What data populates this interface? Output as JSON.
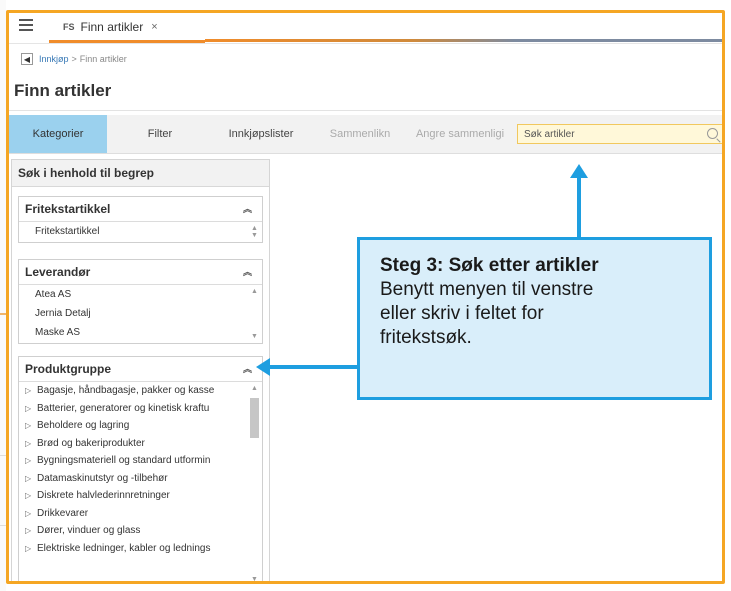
{
  "tab": {
    "badge": "FS",
    "label": "Finn artikler",
    "close": "×"
  },
  "breadcrumb": {
    "parent": "Innkjøp",
    "separator": ">",
    "current": "Finn artikler"
  },
  "page_title": "Finn artikler",
  "toolbar": {
    "kategorier": "Kategorier",
    "filter": "Filter",
    "innkjopslister": "Innkjøpslister",
    "sammenlikn": "Sammenlikn",
    "angre": "Angre sammenligi",
    "search_placeholder": "Søk artikler"
  },
  "left_panel": {
    "heading": "Søk i henhold til begrep",
    "fritekst": {
      "title": "Fritekstartikkel",
      "items": [
        "Fritekstartikkel"
      ]
    },
    "leverandor": {
      "title": "Leverandør",
      "items": [
        "Atea AS",
        "Jernia Detalj",
        "Maske AS"
      ]
    },
    "produktgruppe": {
      "title": "Produktgruppe",
      "items": [
        "Bagasje, håndbagasje, pakker og kasse",
        "Batterier, generatorer og kinetisk kraftu",
        "Beholdere og lagring",
        "Brød og bakeriprodukter",
        "Bygningsmateriell og standard utformin",
        "Datamaskinutstyr og -tilbehør",
        "Diskrete halvlederinnretninger",
        "Drikkevarer",
        "Dører, vinduer og glass",
        "Elektriske ledninger, kabler og lednings"
      ]
    }
  },
  "callout": {
    "title": "Steg 3: Søk etter artikler",
    "body": "Benytt menyen til venstre\neller skriv i feltet for\nfritekstsøk."
  },
  "colors": {
    "accent_orange": "#f5a623",
    "callout_blue": "#1e9ee0",
    "active_tab": "#9bd1ee"
  }
}
